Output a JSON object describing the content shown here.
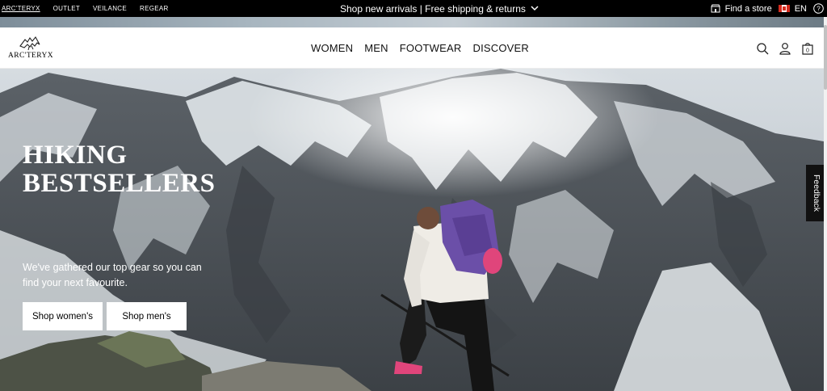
{
  "topbar": {
    "brands": [
      "ARC'TERYX",
      "OUTLET",
      "VEILANCE",
      "ReGEAR"
    ],
    "promo": "Shop new arrivals | Free shipping & returns",
    "find_store": "Find a store",
    "language": "EN"
  },
  "header": {
    "logo_text": "ARC'TERYX",
    "nav": [
      "WOMEN",
      "MEN",
      "FOOTWEAR",
      "DISCOVER"
    ],
    "cart_count": "0"
  },
  "hero": {
    "title_line1": "HIKING",
    "title_line2": "BESTSELLERS",
    "subtitle": "We've gathered our top gear so you can find your next favourite.",
    "btn_women": "Shop women's",
    "btn_men": "Shop men's"
  },
  "feedback_label": "Feedback",
  "icons": [
    "store-icon",
    "canada-flag-icon",
    "help-icon",
    "search-icon",
    "account-icon",
    "cart-icon",
    "chevron-down-icon"
  ],
  "colors": {
    "topbar": "#000000",
    "flag_red": "#d52b1e",
    "backpack": "#6b4fa8",
    "shoe": "#e0457b"
  }
}
